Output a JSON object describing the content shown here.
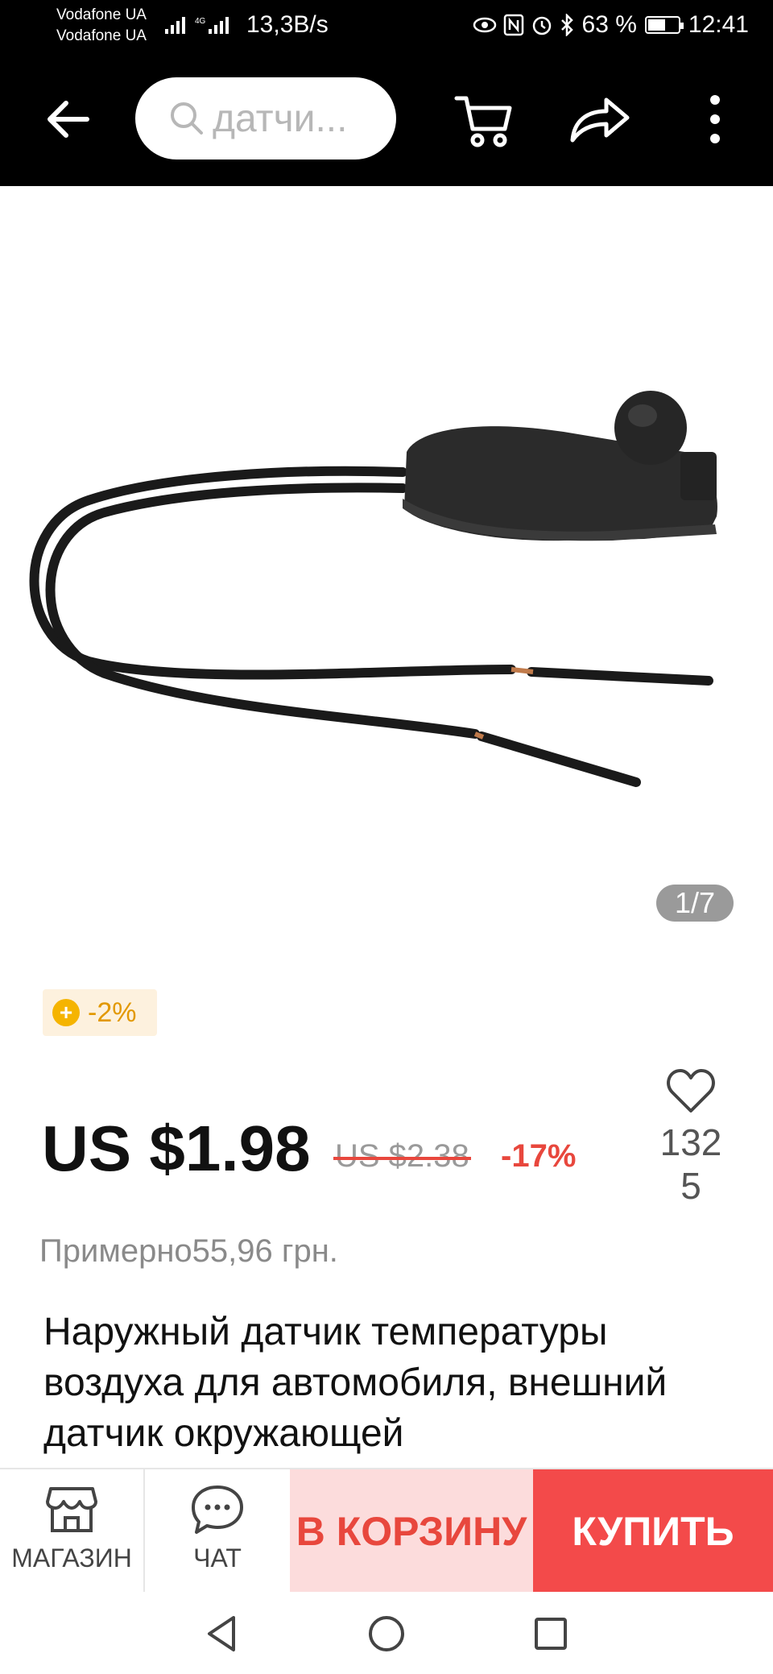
{
  "status_bar": {
    "carrier_1": "Vodafone UA",
    "carrier_2": "Vodafone UA",
    "net_speed": "13,3В/s",
    "battery": "63 %",
    "battery_level_percent": 63,
    "time": "12:41",
    "icons": [
      "signal-icon",
      "4g-signal-icon",
      "eye-icon",
      "nfc-icon",
      "alarm-icon",
      "bluetooth-icon",
      "battery-icon"
    ]
  },
  "header": {
    "search_text": "датчи...",
    "icons": [
      "back-arrow-icon",
      "search-icon",
      "cart-icon",
      "share-icon",
      "more-vertical-icon"
    ]
  },
  "gallery": {
    "counter": "1/7"
  },
  "coin_badge": {
    "icon": "coin-icon",
    "text": "-2%"
  },
  "price": {
    "current": "US $1.98",
    "original": "US $2.38",
    "discount": "-17%"
  },
  "wishlist": {
    "icon": "heart-icon",
    "count": "1325"
  },
  "approx_price": "Примерно55,96 грн.",
  "product_title": "Наружный датчик температуры воздуха для автомобиля, внешний датчик окружающей",
  "bottom_bar": {
    "store_label": "МАГАЗИН",
    "chat_label": "ЧАТ",
    "add_to_cart_label": "В КОРЗИНУ",
    "buy_label": "КУПИТЬ"
  },
  "colors": {
    "accent_red": "#e8473d",
    "buy_red": "#f34a4a",
    "cart_pink": "#fcdcdc",
    "coin_gold": "#f5b400"
  }
}
